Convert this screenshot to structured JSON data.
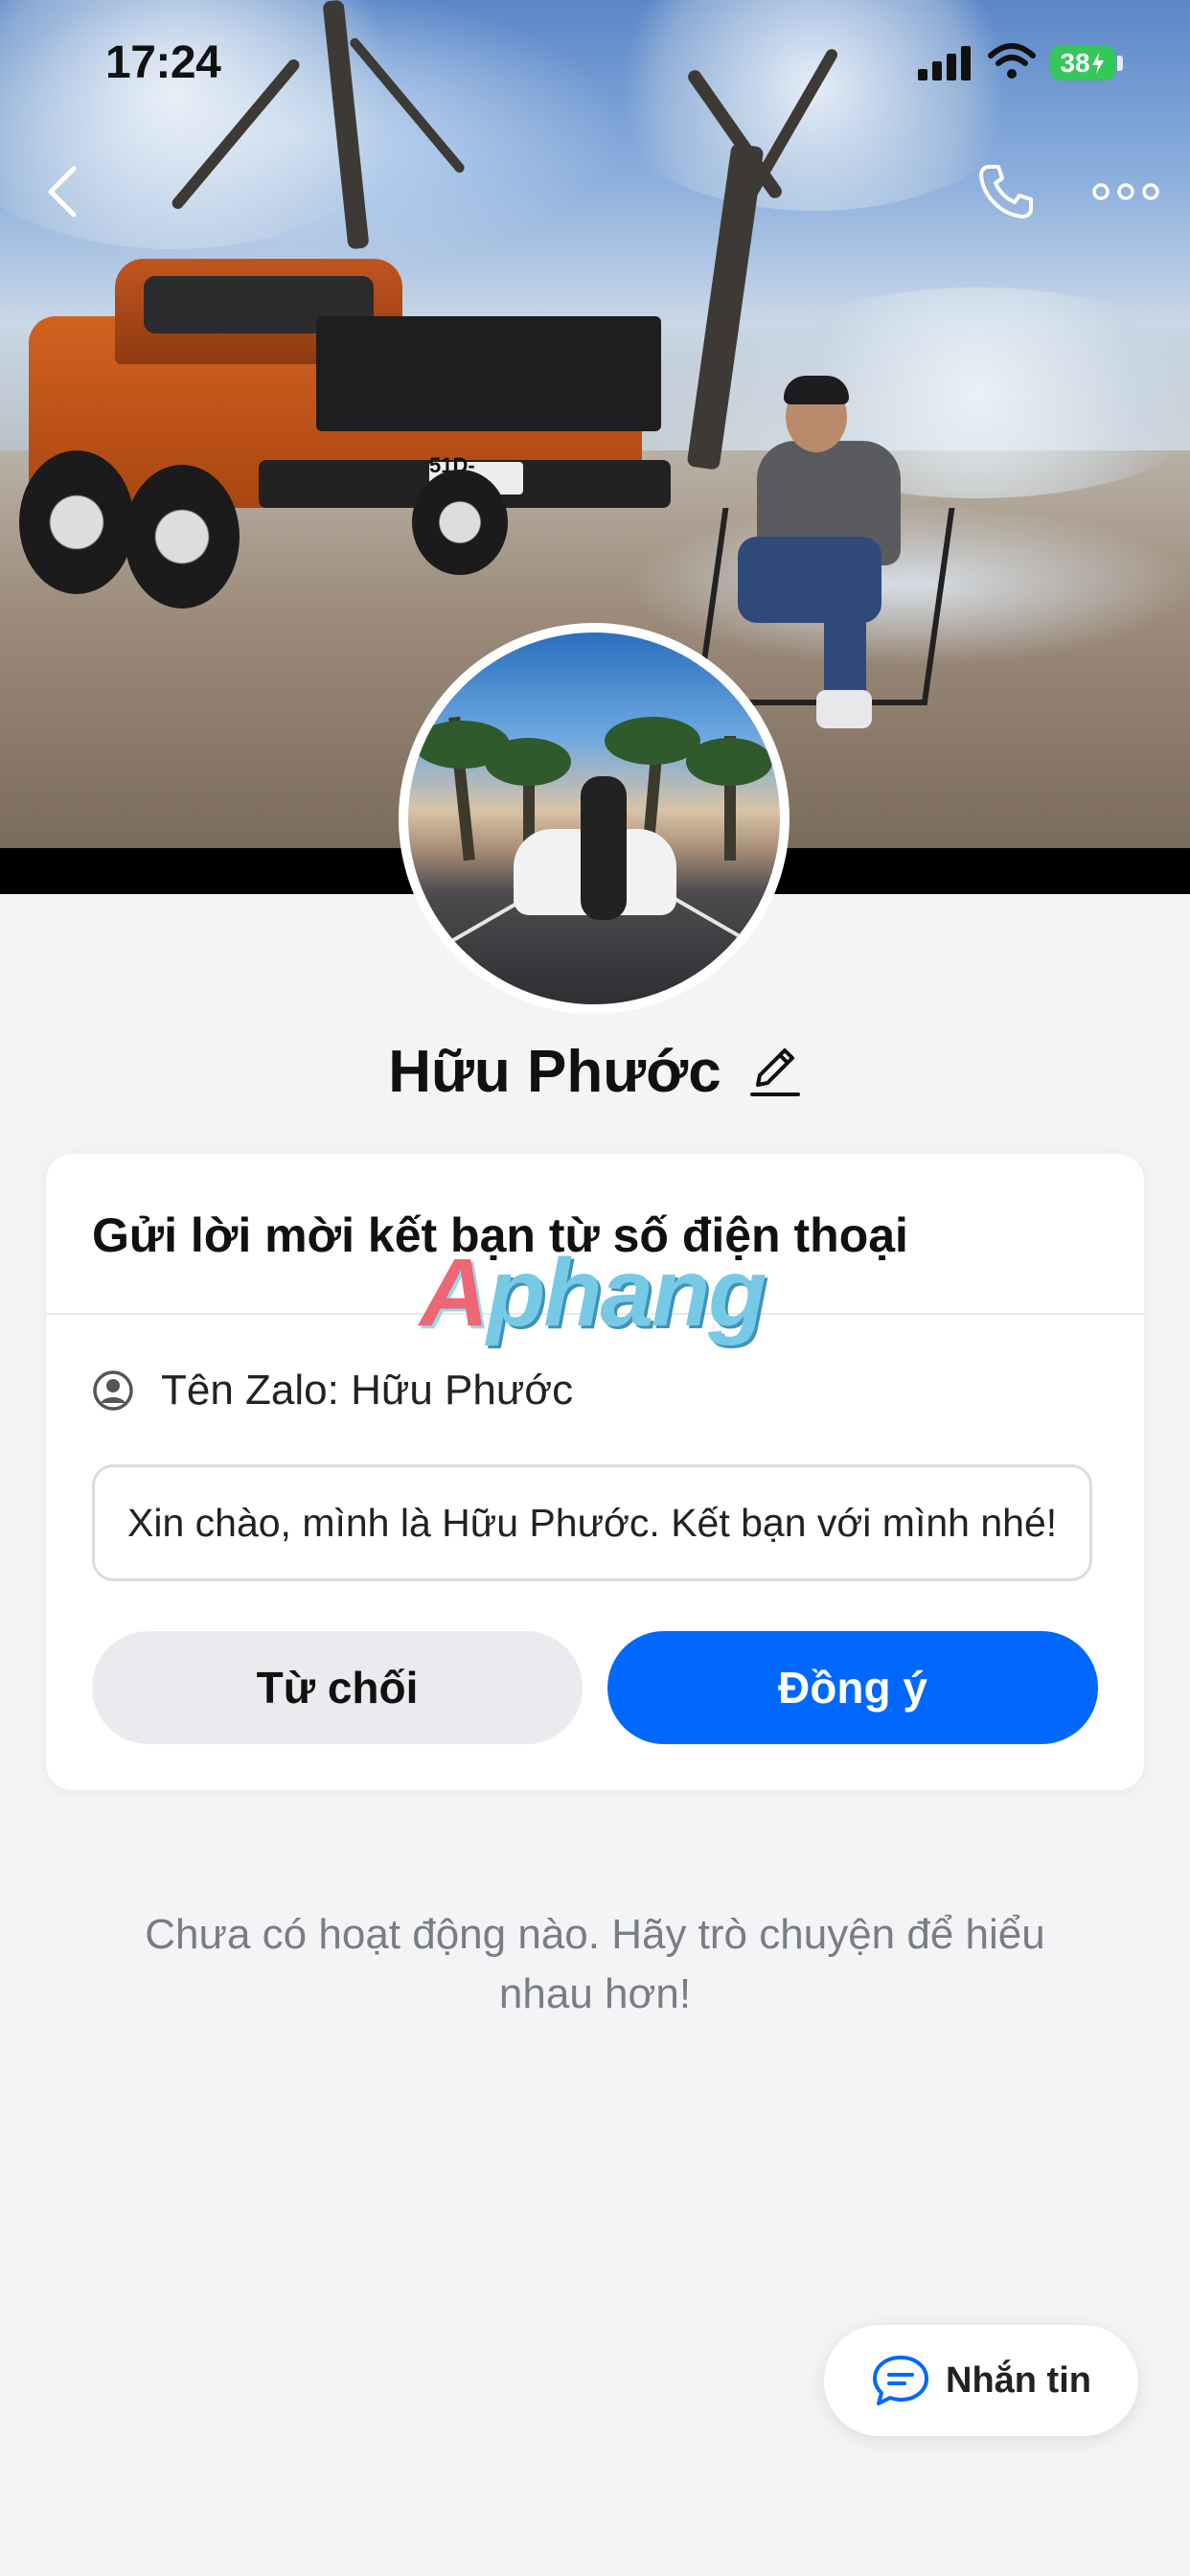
{
  "status_bar": {
    "time": "17:24",
    "battery": "38",
    "icons": [
      "signal-icon",
      "wifi-icon",
      "battery-charging-icon"
    ]
  },
  "nav": {
    "icons": [
      "back-chevron-icon",
      "phone-call-icon",
      "more-options-icon"
    ]
  },
  "cover": {
    "plate_text": "51D-485.10"
  },
  "profile": {
    "name": "Hữu Phước"
  },
  "friend_request": {
    "title": "Gửi lời mời kết bạn từ số điện thoại",
    "zalo_name": "Tên Zalo: Hữu Phước",
    "message": "Xin chào, mình là Hữu Phước. Kết bạn với mình nhé!",
    "decline_label": "Từ chối",
    "accept_label": "Đồng ý"
  },
  "watermark": {
    "first": "A",
    "rest": "phang"
  },
  "empty_state": {
    "text": "Chưa có hoạt động nào. Hãy trò chuyện để hiểu nhau hơn!"
  },
  "chat_fab": {
    "label": "Nhắn tin"
  },
  "colors": {
    "accent": "#0068ff",
    "decline_bg": "#e9ebee",
    "page_bg": "#f3f4f6",
    "battery": "#34c759"
  }
}
